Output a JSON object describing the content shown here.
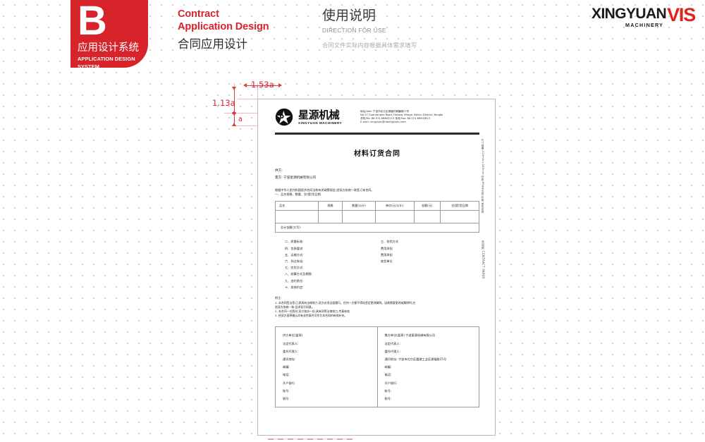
{
  "header": {
    "badge": {
      "letter": "B",
      "cn": "应用设计系统",
      "en_line1": "APPLICATION DESIGN",
      "en_line2": "SYSTEM",
      "color": "#d7232a"
    },
    "contract": {
      "en_line1": "Contract",
      "en_line2": "Application Design",
      "cn": "合同应用设计"
    },
    "usage": {
      "cn": "使用说明",
      "en": "DIRECTION FOR USE",
      "note": "合同文件实际内容根据具体需求填写"
    },
    "vis_logo": {
      "word": "XINGYUAN",
      "sub": "MACHINERY",
      "vis": "VIS",
      "accent": "#e2231a"
    }
  },
  "measurements": {
    "width_label": "1.53a",
    "height_label": "1.13a",
    "unit_label": "a",
    "guide_color": "#e0393f"
  },
  "document": {
    "letterhead": {
      "logo_cn": "星源机械",
      "logo_en": "XINGYUAN MACHINERY",
      "address": [
        "地址/Add: 宁波市北仑区湖塘村黄鳝路27号",
        "No.27 Guantanghe Road, Hutang Village, Beilun District, Ningbo",
        "总机/Tel: 86 574 86802113    传真/Fax: 86 574 86502613",
        "E-mail: xingyuan@nbxingyuan.com"
      ]
    },
    "title": "材料订货合同",
    "parties": [
      "供方:",
      "需方: 宁波星源机械有限公司"
    ],
    "intro": [
      "根据中华人民共和国经济合同法和有关政策规定,经双方协商一致签订本合同。",
      "一、品名规格、数量、交(提)货日期"
    ],
    "goods_table": {
      "headers": [
        "品名",
        "规格",
        "数量(公斤)",
        "单价(元/公斤)",
        "金额(元)",
        "交(提)货日期"
      ],
      "empty_row": [
        "",
        "",
        "",
        "",
        "",
        ""
      ],
      "total_label": "总计金额(大写):"
    },
    "clauses_left": [
      "二、质量标准:",
      "四、包装要求:",
      "五、运输方式:",
      "六、到达车站:",
      "七、交货方式:",
      "八、结算方式及期限:",
      "九、违约责任:",
      "十、其他约定:"
    ],
    "clauses_right": [
      "三、检验方式",
      "费用承担",
      "费用承担",
      "收货单位"
    ],
    "notes": [
      "附注:",
      "1. 本合同签法签订,即具有法律效力,双方必须全面履行。任何一方都不得站签定更改解除。因故需要更改或解除时,应",
      "经双方协商一致,征求双方同意。",
      "2. 本合同一式两份,双方各执一份,具有同等法律效力,传真有效",
      "3. 经双方面草确认同有关传真件可作为本合同的有效补充。"
    ],
    "signature": {
      "left": [
        "供方单位(盖章)",
        "法定代表人:",
        "委托代理人:",
        "通讯地址:",
        "邮编:",
        "电话:",
        "开户银行:",
        "账号:",
        "税号:"
      ],
      "right": [
        "需方单位(盖章)  宁波星源机械有限公司",
        "法定代表人:",
        "委托代理人:",
        "通讯地址:   宁波市北仑区霞浦工业区浦福路15号",
        "邮编:",
        "电话:",
        "开户银行:",
        "账号:",
        "税号:"
      ]
    },
    "side_spec": "尺寸规格:210mm×285mm  材质:80g书写纸  印刷:单色印刷",
    "side_tag": "合同纸 CONTRACT PAPER"
  }
}
